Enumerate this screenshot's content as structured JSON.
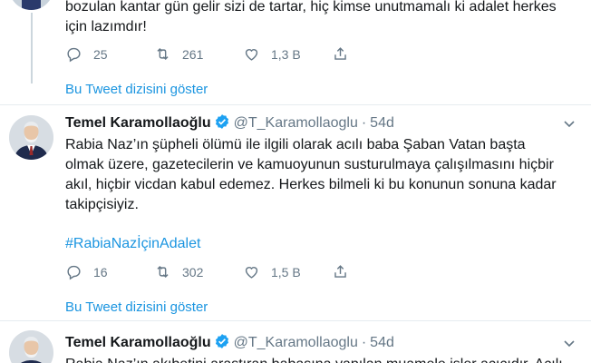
{
  "tweet0": {
    "text_line1": "bozulan kantar gün gelir sizi de tartar, hiç kimse unutmamalı ki adalet herkes",
    "text_line2": "için lazımdır!",
    "replies": "25",
    "retweets": "261",
    "likes": "1,3 B",
    "show_thread": "Bu Tweet dizisini göster"
  },
  "tweet1": {
    "name": "Temel Karamollaoğlu",
    "handle": "@T_Karamollaoglu",
    "dot": "·",
    "time": "54d",
    "lines": [
      "Rabia Naz’ın şüpheli ölümü ile ilgili olarak acılı baba Şaban Vatan başta",
      "olmak üzere, gazetecilerin ve kamuoyunun susturulmaya çalışılmasını hiçbir",
      "akıl, hiçbir vicdan kabul edemez. Herkes bilmeli ki bu konunun sonuna kadar",
      "takipçisiyiz."
    ],
    "hashtag": "#RabiaNazİçinAdalet",
    "replies": "16",
    "retweets": "302",
    "likes": "1,5 B",
    "show_thread": "Bu Tweet dizisini göster"
  },
  "tweet2": {
    "name": "Temel Karamollaoğlu",
    "handle": "@T_Karamollaoglu",
    "dot": "·",
    "time": "54d",
    "partial_text": "Rabia Naz’ın akıbetini araştıran babasına yapılan muamele işler açıcıdır. Acılı"
  },
  "colors": {
    "accent": "#1b95e0",
    "muted": "#657786",
    "divider": "#e6ecf0",
    "verified": "#1da1f2"
  },
  "icons": {
    "reply": "reply-icon",
    "retweet": "retweet-icon",
    "like": "like-icon",
    "share": "share-icon",
    "verified": "verified-badge-icon",
    "caret": "chevron-down-icon"
  }
}
